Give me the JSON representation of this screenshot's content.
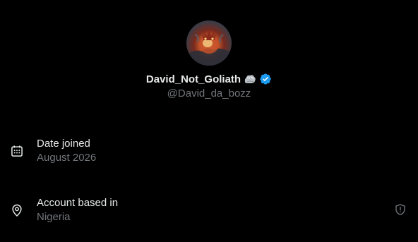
{
  "profile": {
    "display_name": "David_Not_Goliath",
    "handle": "@David_da_bozz",
    "name_emoji": "rock-emoji",
    "verified_color": "#1d9bf0"
  },
  "about": {
    "date_joined": {
      "label": "Date joined",
      "value": "August 2026",
      "icon": "calendar-icon"
    },
    "account_based_in": {
      "label": "Account based in",
      "value": "Nigeria",
      "icon": "location-pin-icon",
      "action_icon": "shield-alert-icon"
    }
  },
  "colors": {
    "background": "#000000",
    "primary_text": "#e7e9ea",
    "secondary_text": "#71767b"
  }
}
